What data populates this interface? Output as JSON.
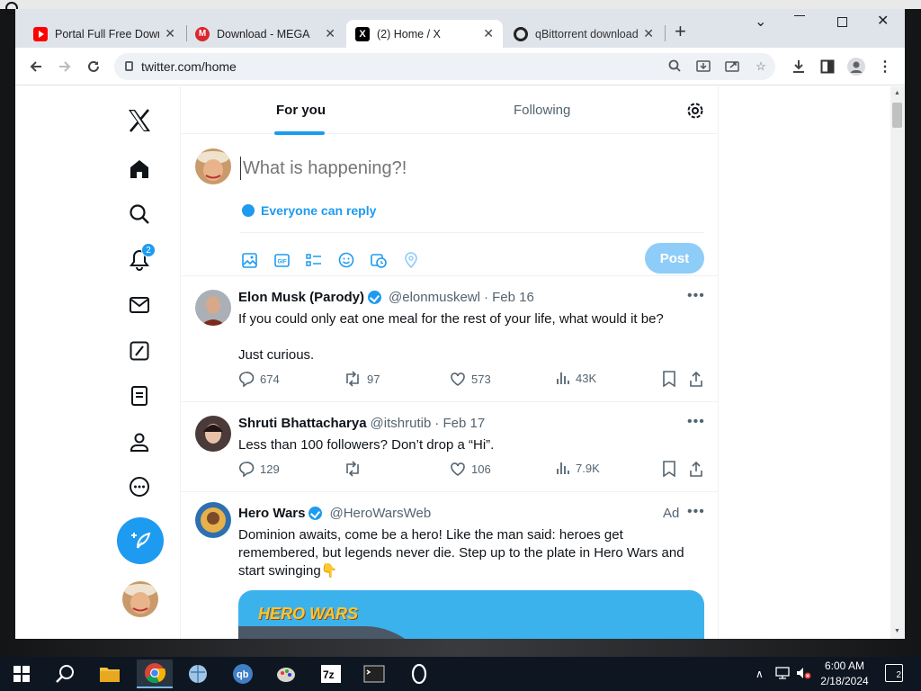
{
  "browser": {
    "tabs": [
      {
        "title": "Portal Full Free Down"
      },
      {
        "title": "Download - MEGA"
      },
      {
        "title": "(2) Home / X"
      },
      {
        "title": "qBittorrent download"
      }
    ],
    "url": "twitter.com/home"
  },
  "sidebar": {
    "notification_count": "2"
  },
  "feed_tabs": {
    "for_you": "For you",
    "following": "Following"
  },
  "compose": {
    "placeholder": "What is happening?!",
    "reply_setting": "Everyone can reply",
    "post_label": "Post"
  },
  "tweets": [
    {
      "name": "Elon Musk (Parody)",
      "handle": "@elonmuskewl",
      "date": "· Feb 16",
      "text": "If you could only eat one meal for the rest of your life, what would it be?\n\nJust curious.",
      "replies": "674",
      "reposts": "97",
      "likes": "573",
      "views": "43K"
    },
    {
      "name": "Shruti Bhattacharya",
      "handle": "@itshrutib",
      "date": "· Feb 17",
      "text": "Less than 100 followers? Don’t drop a “Hi”.",
      "replies": "129",
      "reposts": "",
      "likes": "106",
      "views": "7.9K"
    },
    {
      "name": "Hero Wars",
      "handle": "@HeroWarsWeb",
      "ad_label": "Ad",
      "text": "Dominion awaits, come be a hero! Like the man said: heroes get remembered, but legends never die. Step up to the plate in Hero Wars and start swinging👇",
      "media_title": "HERO WARS"
    }
  ],
  "taskbar": {
    "time": "6:00 AM",
    "date": "2/18/2024",
    "notification_count": "2"
  }
}
